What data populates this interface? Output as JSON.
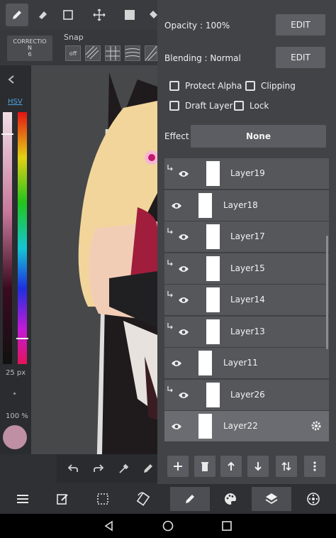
{
  "toolbar": {
    "tools": [
      "pen-icon",
      "eraser-icon",
      "selection-icon",
      "move-icon",
      "fill-color-icon",
      "bucket-icon"
    ],
    "correction_label": "CORRECTIO\nN\n6",
    "snap_label": "Snap",
    "snap_off_label": "off"
  },
  "left_panel": {
    "mode_label": "HSV",
    "brush_size": "25 px",
    "opacity": "100 %",
    "current_color": "#bf8fa3"
  },
  "layer_panel": {
    "opacity_label": "Opacity : 100%",
    "opacity_edit": "EDIT",
    "blending_label": "Blending : Normal",
    "blending_edit": "EDIT",
    "protect_alpha": "Protect Alpha",
    "clipping": "Clipping",
    "draft_layer": "Draft Layer",
    "lock": "Lock",
    "effect_label": "Effect",
    "effect_value": "None",
    "layers": [
      {
        "name": "Layer19",
        "clipped": true,
        "selected": false
      },
      {
        "name": "Layer18",
        "clipped": false,
        "selected": false
      },
      {
        "name": "Layer17",
        "clipped": true,
        "selected": false
      },
      {
        "name": "Layer15",
        "clipped": true,
        "selected": false
      },
      {
        "name": "Layer14",
        "clipped": true,
        "selected": false
      },
      {
        "name": "Layer13",
        "clipped": true,
        "selected": false
      },
      {
        "name": "Layer11",
        "clipped": false,
        "selected": false
      },
      {
        "name": "Layer26",
        "clipped": true,
        "selected": false
      },
      {
        "name": "Layer22",
        "clipped": false,
        "selected": true
      }
    ],
    "actions": [
      "add-layer-icon",
      "delete-layer-icon",
      "move-up-icon",
      "move-down-icon",
      "swap-icon",
      "more-icon"
    ]
  },
  "bottom_bar": {
    "items": [
      "menu-icon",
      "edit-icon",
      "selection-icon",
      "rotate-icon",
      "pen-icon",
      "palette-icon",
      "layers-icon",
      "settings-icon"
    ],
    "selected": [
      "pen-icon",
      "layers-icon"
    ]
  },
  "colors": {
    "accent": "#4aa3df",
    "panel": "#424347"
  }
}
